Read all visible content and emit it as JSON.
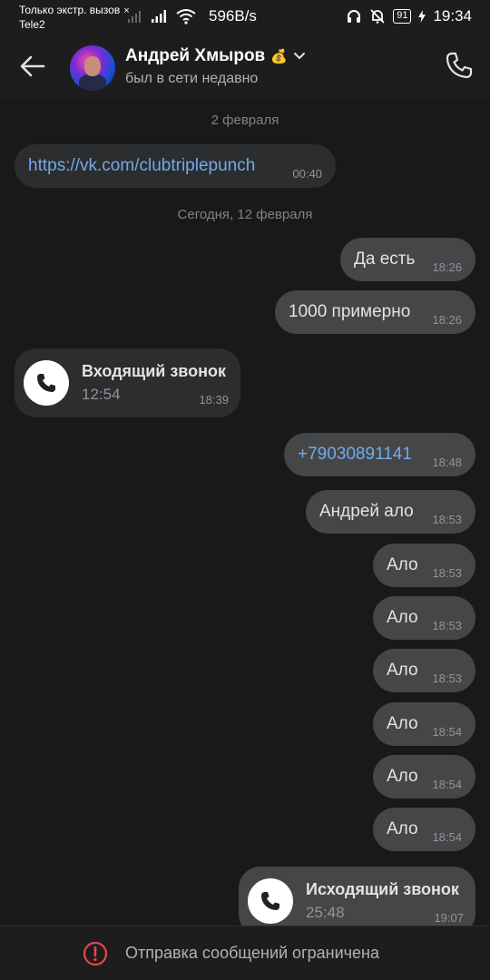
{
  "status_bar": {
    "line1": "Только экстр. вызов",
    "close_mark": "×",
    "line2": "Tele2",
    "speed": "596B/s",
    "battery": "91",
    "time": "19:34"
  },
  "header": {
    "name": "Андрей Хмыров",
    "emoji": "💰",
    "status": "был в сети недавно"
  },
  "chat": {
    "date1": "2 февраля",
    "date2": "Сегодня, 12 февраля",
    "messages": [
      {
        "text": "https://vk.com/clubtriplepunch",
        "time": "00:40"
      },
      {
        "text": "Да есть",
        "time": "18:26"
      },
      {
        "text": "1000 примерно",
        "time": "18:26"
      },
      {
        "title": "Входящий звонок",
        "duration": "12:54",
        "time": "18:39"
      },
      {
        "text": "+79030891141",
        "time": "18:48"
      },
      {
        "text": "Андрей ало",
        "time": "18:53"
      },
      {
        "text": "Ало",
        "time": "18:53"
      },
      {
        "text": "Ало",
        "time": "18:53"
      },
      {
        "text": "Ало",
        "time": "18:53"
      },
      {
        "text": "Ало",
        "time": "18:54"
      },
      {
        "text": "Ало",
        "time": "18:54"
      },
      {
        "text": "Ало",
        "time": "18:54"
      },
      {
        "title": "Исходящий звонок",
        "duration": "25:48",
        "time": "19:07"
      }
    ]
  },
  "bottom": {
    "notice": "Отправка сообщений ограничена"
  },
  "colors": {
    "background": "#19191a",
    "bubble_in": "#2c2d2e",
    "bubble_out": "#454647",
    "link": "#71aaeb",
    "warning": "#e64646"
  }
}
